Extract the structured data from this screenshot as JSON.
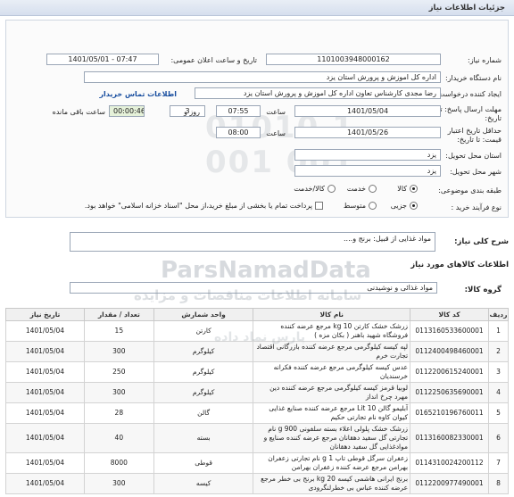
{
  "header": {
    "title": "جزئیات اطلاعات نیاز"
  },
  "form": {
    "need_number_label": "شماره نیاز:",
    "need_number": "1101003948000162",
    "announce_label": "تاریخ و ساعت اعلان عمومی:",
    "announce_value": "1401/05/01 - 07:47",
    "buyer_label": "نام دستگاه خریدار:",
    "buyer_value": "اداره کل اموزش و پرورش استان یزد",
    "creator_label": "ایجاد کننده درخواست:",
    "creator_value": "رضا مجدی کارشناس تعاون اداره کل اموزش و پرورش استان یزد",
    "contact_link": "اطلاعات تماس خریدار",
    "deadline_label": "مهلت ارسال پاسخ: تا تاریخ:",
    "deadline_date": "1401/05/04",
    "time_label": "ساعت",
    "deadline_time": "07:55",
    "days_value": "3",
    "days_label": "روز و",
    "remaining_time": "00:00:46",
    "remaining_label": "ساعت باقی مانده",
    "validity_label": "حداقل تاریخ اعتبار قیمت: تا تاریخ:",
    "validity_date": "1401/05/26",
    "validity_time_label": "ساعت",
    "validity_time": "08:00",
    "province_label": "استان محل تحویل:",
    "province_value": "یزد",
    "city_label": "شهر محل تحویل:",
    "city_value": "یزد",
    "category_label": "طبقه بندی موضوعی:",
    "category_options": [
      "کالا",
      "خدمت",
      "کالا/خدمت"
    ],
    "category_selected": "کالا",
    "process_label": "نوع فرآیند خرید :",
    "process_options": [
      "جزیی",
      "متوسط"
    ],
    "process_selected": "جزیی",
    "payment_note": "پرداخت تمام یا بخشی از مبلغ خرید،از محل \"اسناد خزانه اسلامی\" خواهد بود."
  },
  "description": {
    "label": "شرح کلی نیاز:",
    "value": "مواد غذایی از قبیل: برنج و...."
  },
  "goods_section_title": "اطلاعات کالاهای مورد نیاز",
  "group": {
    "label": "گروه کالا:",
    "value": "مواد غذائی و نوشیدنی"
  },
  "table": {
    "headers": [
      "ردیف",
      "کد کالا",
      "نام کالا",
      "واحد شمارش",
      "تعداد / مقدار",
      "تاریخ نیاز"
    ],
    "rows": [
      {
        "row": "1",
        "code": "0113160533600001",
        "name": "زرشک خشک کارتن 10 kg مرجع عرضه کننده فروشگاه شهید باهنر ( بکان مزه )",
        "unit": "کارتن",
        "qty": "15",
        "date": "1401/05/04"
      },
      {
        "row": "2",
        "code": "0112400498460001",
        "name": "لپه کیسه کیلوگرمی مرجع عرضه کننده بازرگانی اقتصاد تجارت خرم",
        "unit": "کیلوگرم",
        "qty": "300",
        "date": "1401/05/04"
      },
      {
        "row": "3",
        "code": "0112200615240001",
        "name": "عدس کیسه کیلوگرمی مرجع عرضه کننده فکرانه خرسندیان",
        "unit": "کیلوگرم",
        "qty": "250",
        "date": "1401/05/04"
      },
      {
        "row": "4",
        "code": "0112250635690001",
        "name": "لوبیا قرمز کیسه کیلوگرمی مرجع عرضه کننده دین مهرد چرخ انداز",
        "unit": "کیلوگرم",
        "qty": "300",
        "date": "1401/05/04"
      },
      {
        "row": "5",
        "code": "0165210196760011",
        "name": "آبلیمو گالن 10 Lit مرجع عرضه کننده صنایع غذایی کیوان کاوه نام تجارتی حکیم",
        "unit": "گالن",
        "qty": "28",
        "date": "1401/05/04"
      },
      {
        "row": "6",
        "code": "0113160082330001",
        "name": "زرشک خشک پلولی اعلاء بسته سلفونی 900 g نام تجارتی گل سفید دهقانان مرجع عرضه کننده صنایع و موادغذایی گل سفید دهقانان",
        "unit": "بسته",
        "qty": "40",
        "date": "1401/05/04"
      },
      {
        "row": "7",
        "code": "0114310024200112",
        "name": "زعفران سرگل قوطی تاپ 1 g نام تجارتی زعفران بهرامن مرجع عرضه کننده زعفران بهرامن",
        "unit": "قوطی",
        "qty": "8000",
        "date": "1401/05/04"
      },
      {
        "row": "8",
        "code": "0112200977490001",
        "name": "برنج ایرانی هاشمی کیسه 20 kg برنج بی خطر مرجع عرضه کننده عباس بی خطرلنگرودی",
        "unit": "کیسه",
        "qty": "300",
        "date": "1401/05/04"
      }
    ]
  }
}
